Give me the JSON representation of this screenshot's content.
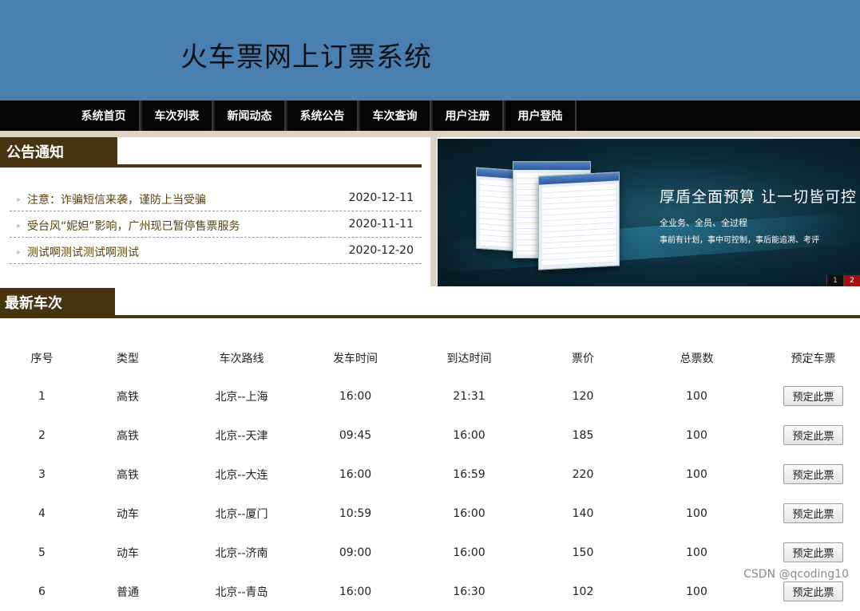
{
  "site": {
    "title": "火车票网上订票系统"
  },
  "nav": {
    "items": [
      "系统首页",
      "车次列表",
      "新闻动态",
      "系统公告",
      "车次查询",
      "用户注册",
      "用户登陆"
    ]
  },
  "notice": {
    "heading": "公告通知",
    "items": [
      {
        "title": "注意：诈骗短信来袭，谨防上当受骗",
        "date": "2020-12-11"
      },
      {
        "title": "受台风“妮妲”影响，广州现已暂停售票服务",
        "date": "2020-11-11"
      },
      {
        "title": "测试啊测试测试啊测试",
        "date": "2020-12-20"
      }
    ]
  },
  "banner": {
    "headline": "厚盾全面预算  让一切皆可控",
    "sub1": "全业务、全员、全过程",
    "sub2": "事前有计划，事中可控制，事后能追溯、考评",
    "pager": [
      "1",
      "2"
    ],
    "active_page": "2"
  },
  "trains": {
    "heading": "最新车次",
    "columns": [
      "序号",
      "类型",
      "车次路线",
      "发车时间",
      "到达时间",
      "票价",
      "总票数",
      "预定车票"
    ],
    "book_label": "预定此票",
    "rows": [
      [
        "1",
        "高铁",
        "北京--上海",
        "16:00",
        "21:31",
        "120",
        "100"
      ],
      [
        "2",
        "高铁",
        "北京--天津",
        "09:45",
        "16:00",
        "185",
        "100"
      ],
      [
        "3",
        "高铁",
        "北京--大连",
        "16:00",
        "16:59",
        "220",
        "100"
      ],
      [
        "4",
        "动车",
        "北京--厦门",
        "10:59",
        "16:00",
        "140",
        "100"
      ],
      [
        "5",
        "动车",
        "北京--济南",
        "09:00",
        "16:00",
        "150",
        "100"
      ],
      [
        "6",
        "普通",
        "北京--青岛",
        "16:00",
        "16:30",
        "102",
        "100"
      ]
    ]
  },
  "watermark": "CSDN @qcoding10",
  "colors": {
    "header": "#4a7fb2",
    "nav": "#050505",
    "section": "#473511",
    "stripe": "#dcd3c2"
  }
}
